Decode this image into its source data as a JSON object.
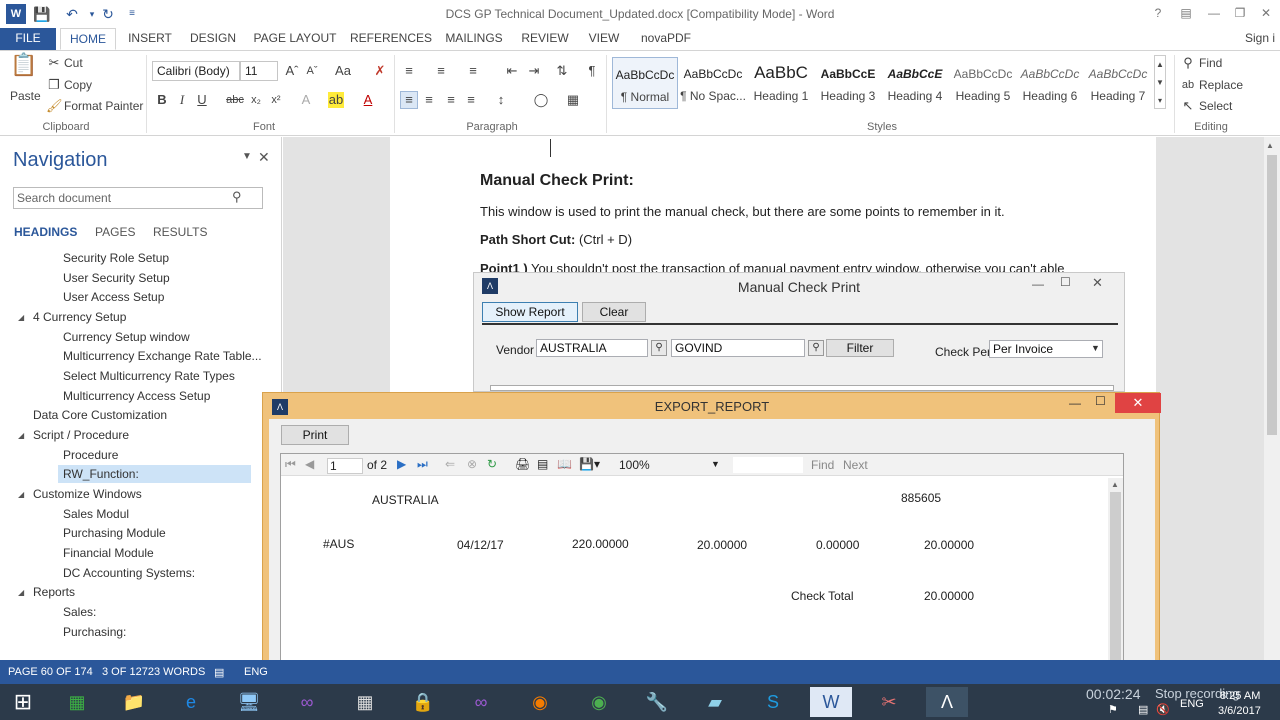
{
  "window": {
    "title": "DCS GP Technical Document_Updated.docx [Compatibility Mode] - Word"
  },
  "ribbon": {
    "tabs": [
      "FILE",
      "HOME",
      "INSERT",
      "DESIGN",
      "PAGE LAYOUT",
      "REFERENCES",
      "MAILINGS",
      "REVIEW",
      "VIEW",
      "novaPDF"
    ],
    "signin": "Sign i",
    "clipboard": {
      "paste": "Paste",
      "cut": "Cut",
      "copy": "Copy",
      "format_painter": "Format Painter",
      "label": "Clipboard"
    },
    "font": {
      "name": "Calibri (Body)",
      "size": "11",
      "label": "Font"
    },
    "paragraph": {
      "label": "Paragraph"
    },
    "styles": {
      "label": "Styles",
      "items": [
        {
          "sample": "AaBbCcDc",
          "name": "¶ Normal"
        },
        {
          "sample": "AaBbCcDc",
          "name": "¶ No Spac..."
        },
        {
          "sample": "AaBbC",
          "name": "Heading 1"
        },
        {
          "sample": "AaBbCcE",
          "name": "Heading 3"
        },
        {
          "sample": "AaBbCcE",
          "name": "Heading 4"
        },
        {
          "sample": "AaBbCcDc",
          "name": "Heading 5"
        },
        {
          "sample": "AaBbCcDc",
          "name": "Heading 6"
        },
        {
          "sample": "AaBbCcDc",
          "name": "Heading 7"
        }
      ]
    },
    "editing": {
      "find": "Find",
      "replace": "Replace",
      "select": "Select",
      "label": "Editing"
    }
  },
  "navigation": {
    "title": "Navigation",
    "search_placeholder": "Search document",
    "tabs": [
      "HEADINGS",
      "PAGES",
      "RESULTS"
    ],
    "items": [
      {
        "label": "Security Role Setup"
      },
      {
        "label": "User Security Setup"
      },
      {
        "label": "User Access Setup"
      },
      {
        "label": "4 Currency Setup"
      },
      {
        "label": "Currency Setup window"
      },
      {
        "label": "Multicurrency Exchange Rate Table..."
      },
      {
        "label": "Select Multicurrency Rate Types"
      },
      {
        "label": "Multicurrency Access Setup"
      },
      {
        "label": "Data Core Customization"
      },
      {
        "label": "Script / Procedure"
      },
      {
        "label": "Procedure"
      },
      {
        "label": "RW_Function:"
      },
      {
        "label": "Customize Windows"
      },
      {
        "label": "Sales Modul"
      },
      {
        "label": "Purchasing Module"
      },
      {
        "label": "Financial Module"
      },
      {
        "label": "DC Accounting Systems:"
      },
      {
        "label": "Reports"
      },
      {
        "label": "Sales:"
      },
      {
        "label": "Purchasing:"
      }
    ]
  },
  "document": {
    "heading": "Manual Check Print:",
    "para1": "This window is used to print the manual check, but there are some points to remember in it.",
    "path_label": "Path Short Cut:",
    "path_value": " (Ctrl + D)",
    "point1_label": "Point1 )",
    "point1_text": " You shouldn't post the transaction of manual payment entry window, otherwise you can't able"
  },
  "manual_check": {
    "title": "Manual Check Print",
    "show_report": "Show Report",
    "clear": "Clear",
    "vendor_label": "Vendor",
    "vendor_from": "AUSTRALIA",
    "vendor_to": "GOVIND",
    "filter": "Filter",
    "check_per_label": "Check Per",
    "check_per_value": "Per Invoice"
  },
  "export_report": {
    "title": "EXPORT_REPORT",
    "print": "Print",
    "page_current": "1",
    "page_of": "of 2",
    "zoom": "100%",
    "find": "Find",
    "next": "Next",
    "report": {
      "vendor": "AUSTRALIA",
      "check_no": "885605",
      "row": [
        "#AUS",
        "04/12/17",
        "220.00000",
        "20.00000",
        "0.00000",
        "20.00000"
      ],
      "total_label": "Check Total",
      "total_value": "20.00000"
    }
  },
  "statusbar": {
    "page": "PAGE 60 OF 174",
    "words": "3 OF 12723 WORDS",
    "lang": "ENG"
  },
  "taskbar": {
    "recording_time": "00:02:24",
    "stop_recording": "Stop recording",
    "lang": "ENG",
    "time": "8:25 AM",
    "date": "3/6/2017"
  }
}
